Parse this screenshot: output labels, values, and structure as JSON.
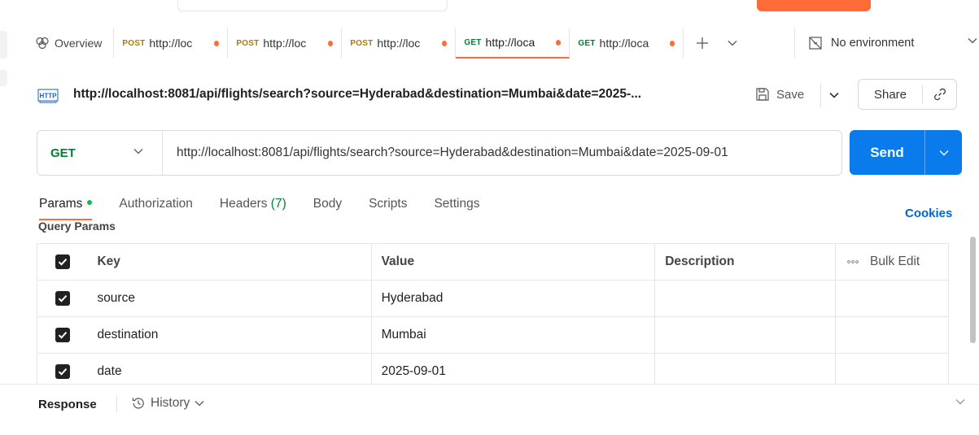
{
  "tabs": {
    "overview_label": "Overview",
    "items": [
      {
        "method": "POST",
        "label": "http://loc",
        "active": false
      },
      {
        "method": "POST",
        "label": "http://loc",
        "active": false
      },
      {
        "method": "POST",
        "label": "http://loc",
        "active": false
      },
      {
        "method": "GET",
        "label": "http://loca",
        "active": true
      },
      {
        "method": "GET",
        "label": "http://loca",
        "active": false
      }
    ],
    "environment": "No environment"
  },
  "request": {
    "title": "http://localhost:8081/api/flights/search?source=Hyderabad&destination=Mumbai&date=2025-...",
    "save_label": "Save",
    "share_label": "Share",
    "method": "GET",
    "url": "http://localhost:8081/api/flights/search?source=Hyderabad&destination=Mumbai&date=2025-09-01",
    "send_label": "Send"
  },
  "subtabs": {
    "params": "Params",
    "authorization": "Authorization",
    "headers": "Headers",
    "headers_count": "(7)",
    "body": "Body",
    "scripts": "Scripts",
    "settings": "Settings",
    "cookies": "Cookies"
  },
  "query_params": {
    "title": "Query Params",
    "headers": {
      "key": "Key",
      "value": "Value",
      "description": "Description",
      "bulk_edit": "Bulk Edit"
    },
    "rows": [
      {
        "key": "source",
        "value": "Hyderabad",
        "description": ""
      },
      {
        "key": "destination",
        "value": "Mumbai",
        "description": ""
      },
      {
        "key": "date",
        "value": "2025-09-01",
        "description": ""
      }
    ]
  },
  "response": {
    "label": "Response",
    "history_label": "History"
  },
  "colors": {
    "accent_orange": "#ff6c37",
    "send_blue": "#097bed",
    "get_green": "#007f31",
    "post_amber": "#ad7a03",
    "cookies_blue": "#0265d2"
  }
}
